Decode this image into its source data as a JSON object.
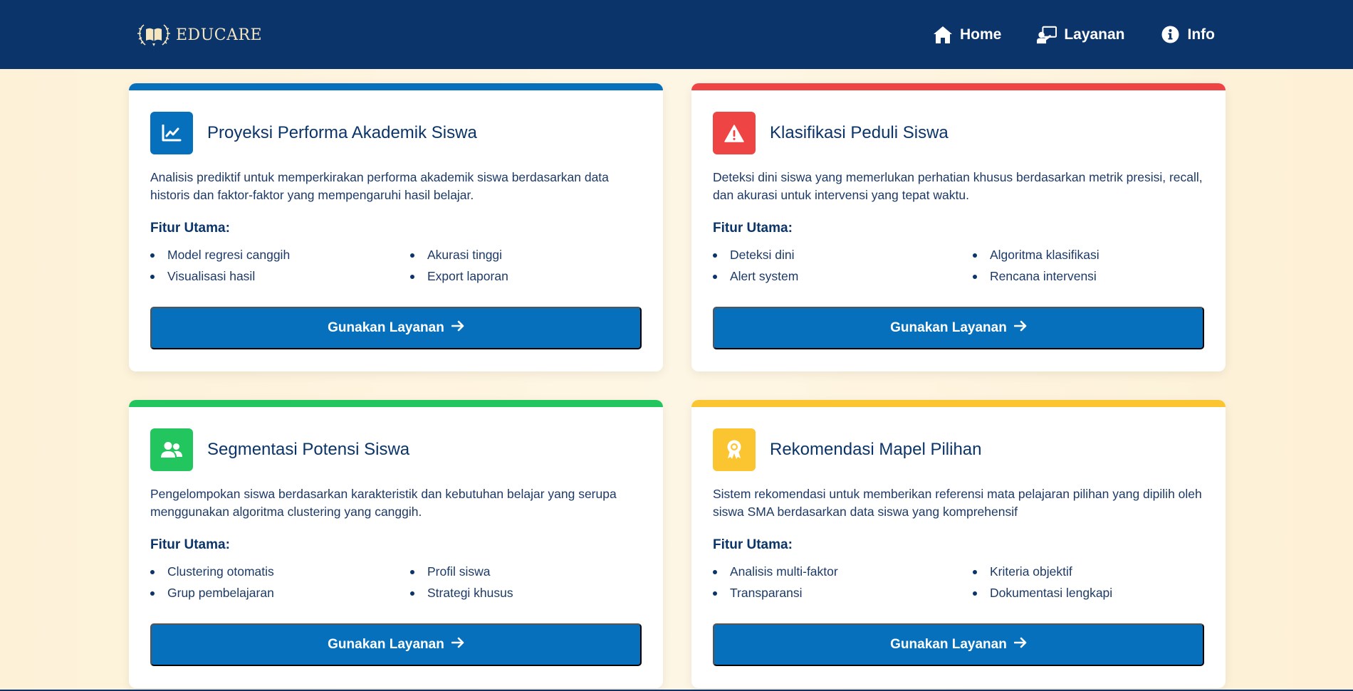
{
  "brand": {
    "name": "EDUCARE",
    "logo_icon": "book-laurel-icon"
  },
  "nav": [
    {
      "label": "Home",
      "icon": "home-icon"
    },
    {
      "label": "Layanan",
      "icon": "chalkboard-teacher-icon"
    },
    {
      "label": "Info",
      "icon": "info-circle-icon"
    }
  ],
  "cards": [
    {
      "title": "Proyeksi Performa Akademik Siswa",
      "description": "Analisis prediktif untuk memperkirakan performa akademik siswa berdasarkan data historis dan faktor-faktor yang mempengaruhi hasil belajar.",
      "features_title": "Fitur Utama:",
      "features": [
        "Model regresi canggih",
        "Akurasi tinggi",
        "Visualisasi hasil",
        "Export laporan"
      ],
      "button": "Gunakan Layanan",
      "accent": "#0670bd",
      "icon": "chart-line-icon"
    },
    {
      "title": "Klasifikasi Peduli Siswa",
      "description": "Deteksi dini siswa yang memerlukan perhatian khusus berdasarkan metrik presisi, recall, dan akurasi untuk intervensi yang tepat waktu.",
      "features_title": "Fitur Utama:",
      "features": [
        "Deteksi dini",
        "Algoritma klasifikasi",
        "Alert system",
        "Rencana intervensi"
      ],
      "button": "Gunakan Layanan",
      "accent": "#ef4444",
      "icon": "warning-triangle-icon"
    },
    {
      "title": "Segmentasi Potensi Siswa",
      "description": "Pengelompokan siswa berdasarkan karakteristik dan kebutuhan belajar yang serupa menggunakan algoritma clustering yang canggih.",
      "features_title": "Fitur Utama:",
      "features": [
        "Clustering otomatis",
        "Profil siswa",
        "Grup pembelajaran",
        "Strategi khusus"
      ],
      "button": "Gunakan Layanan",
      "accent": "#22c55e",
      "icon": "users-icon"
    },
    {
      "title": "Rekomendasi Mapel Pilihan",
      "description": "Sistem rekomendasi untuk memberikan referensi mata pelajaran pilihan yang dipilih oleh siswa SMA berdasarkan data siswa yang komprehensif",
      "features_title": "Fitur Utama:",
      "features": [
        "Analisis multi-faktor",
        "Kriteria objektif",
        "Transparansi",
        "Dokumentasi lengkapi"
      ],
      "button": "Gunakan Layanan",
      "accent": "#fbc531",
      "icon": "award-icon"
    }
  ]
}
